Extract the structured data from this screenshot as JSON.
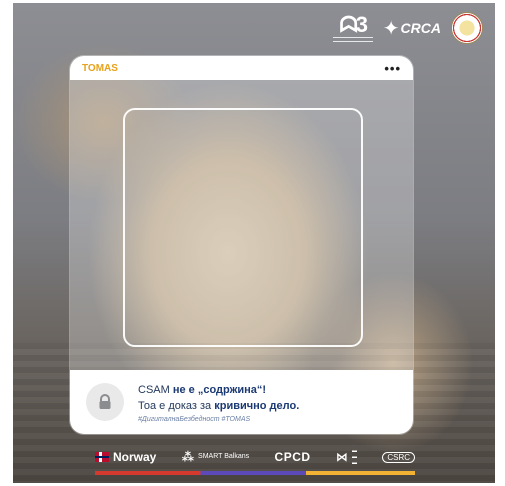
{
  "header_logos": {
    "crca": "CRCA"
  },
  "card": {
    "brand": "TOMAS",
    "menu": "•••",
    "line1_prefix": "CSAM ",
    "line1_bold": "не е „содржина“!",
    "line2_prefix": "Тоа е доказ за ",
    "line2_bold": "кривично дело.",
    "hashtags": "#ДигиталнаБезбедност #TOMAS"
  },
  "partners": {
    "norway": "Norway",
    "smart": "SMART Balkans",
    "cpcd": "CPCD",
    "csrc": "CSRC"
  },
  "icons": [
    "lock-icon",
    "menu-dots-icon"
  ]
}
